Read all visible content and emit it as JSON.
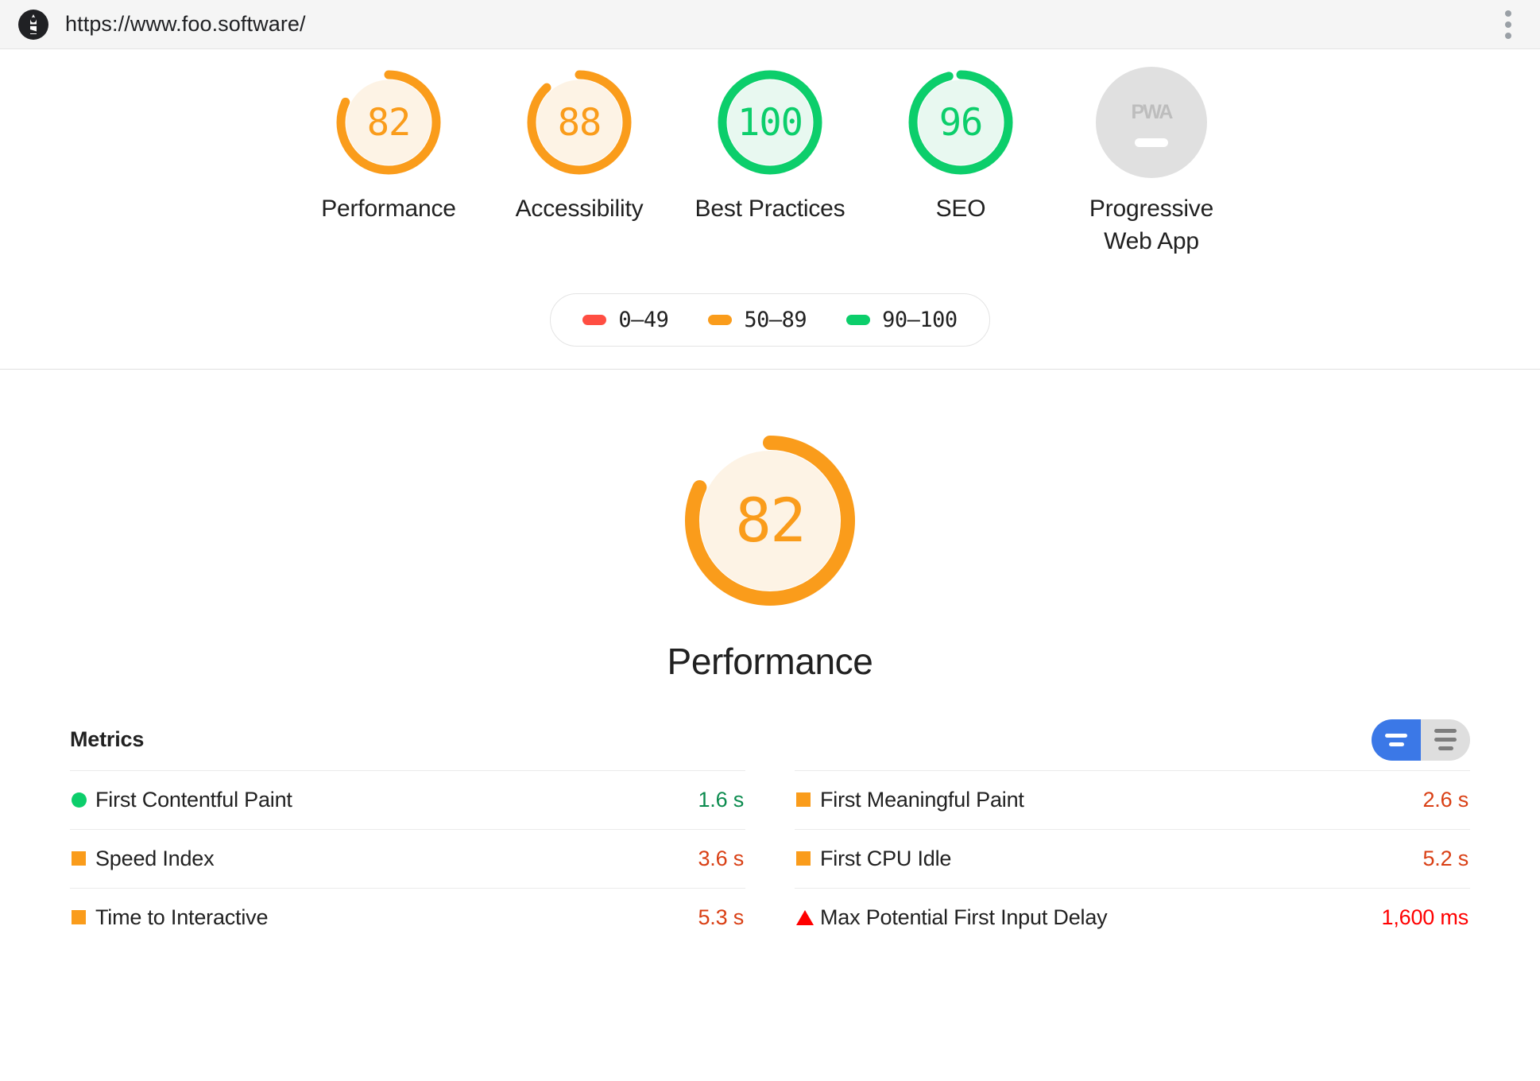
{
  "header": {
    "url": "https://www.foo.software/",
    "logo_name": "lighthouse-logo",
    "menu_name": "more-options"
  },
  "colors": {
    "orange": "#fa9c1b",
    "green": "#0cce6b",
    "red": "#ff4e42",
    "gray": "#e0e0e0",
    "value_orange": "#d93f14",
    "value_green": "#0b8b4e",
    "value_red": "#ff0000",
    "accent_blue": "#3b78e7"
  },
  "scores": [
    {
      "label": "Performance",
      "value": "82",
      "score": 82,
      "band": "orange"
    },
    {
      "label": "Accessibility",
      "value": "88",
      "score": 88,
      "band": "orange"
    },
    {
      "label": "Best Practices",
      "value": "100",
      "score": 100,
      "band": "green"
    },
    {
      "label": "SEO",
      "value": "96",
      "score": 96,
      "band": "green"
    },
    {
      "label": "Progressive\nWeb App",
      "value": "PWA",
      "score": null,
      "band": "gray"
    }
  ],
  "legend": {
    "items": [
      {
        "label": "0–49",
        "color": "#ff4e42"
      },
      {
        "label": "50–89",
        "color": "#fa9c1b"
      },
      {
        "label": "90–100",
        "color": "#0cce6b"
      }
    ]
  },
  "category": {
    "title": "Performance",
    "value": "82",
    "score": 82
  },
  "metrics": {
    "title": "Metrics",
    "toggle": {
      "simple_label": "simple-view",
      "expanded_label": "expanded-view",
      "active": "simple"
    },
    "rows": [
      {
        "name": "First Contentful Paint",
        "value": "1.6 s",
        "marker": "circle",
        "marker_color": "#0cce6b",
        "value_color": "#0b8b4e"
      },
      {
        "name": "First Meaningful Paint",
        "value": "2.6 s",
        "marker": "square",
        "marker_color": "#fa9c1b",
        "value_color": "#d93f14"
      },
      {
        "name": "Speed Index",
        "value": "3.6 s",
        "marker": "square",
        "marker_color": "#fa9c1b",
        "value_color": "#d93f14"
      },
      {
        "name": "First CPU Idle",
        "value": "5.2 s",
        "marker": "square",
        "marker_color": "#fa9c1b",
        "value_color": "#d93f14"
      },
      {
        "name": "Time to Interactive",
        "value": "5.3 s",
        "marker": "square",
        "marker_color": "#fa9c1b",
        "value_color": "#d93f14"
      },
      {
        "name": "Max Potential First Input Delay",
        "value": "1,600 ms",
        "marker": "triangle",
        "marker_color": "#ff0000",
        "value_color": "#ff0000"
      }
    ]
  }
}
